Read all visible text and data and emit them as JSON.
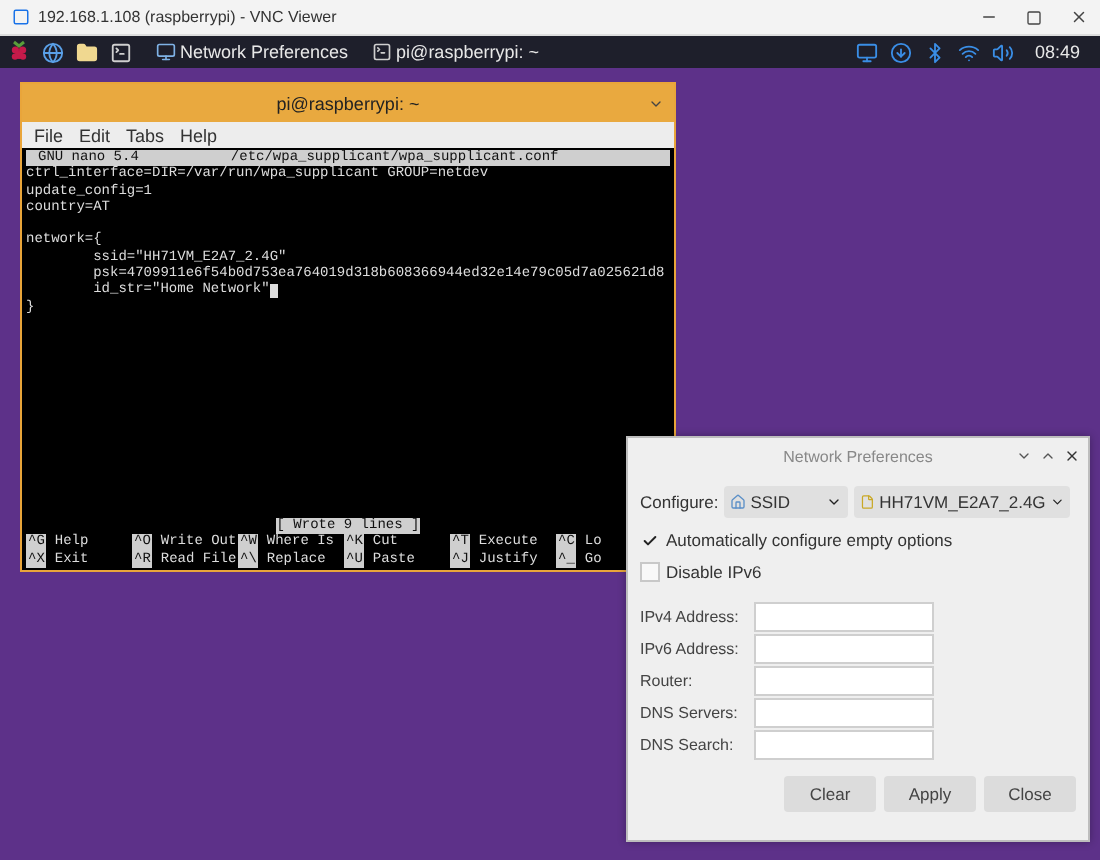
{
  "viewer": {
    "title": "192.168.1.108 (raspberrypi) - VNC Viewer"
  },
  "taskbar": {
    "tasks": [
      {
        "label": "Network Preferences",
        "kind": "network"
      },
      {
        "label": "pi@raspberrypi: ~",
        "kind": "terminal"
      }
    ],
    "clock": "08:49"
  },
  "terminal": {
    "title": "pi@raspberrypi: ~",
    "menu": [
      "File",
      "Edit",
      "Tabs",
      "Help"
    ],
    "nano": {
      "version": "GNU nano 5.4",
      "file": "/etc/wpa_supplicant/wpa_supplicant.conf",
      "blocks": [
        [
          {
            "text": "ctrl_interface=DIR=/var/run/wpa_supplicant GROUP=netdev",
            "cursor": false
          },
          {
            "text": "update_config=1",
            "cursor": false
          },
          {
            "text": "country=AT",
            "cursor": false
          }
        ],
        [
          {
            "text": "network={",
            "cursor": false
          },
          {
            "text": "        ssid=\"HH71VM_E2A7_2.4G\"",
            "cursor": false
          },
          {
            "text": "        psk=4709911e6f54b0d753ea764019d318b608366944ed32e14e79c05d7a025621d8",
            "cursor": false
          },
          {
            "text": "        id_str=\"Home Network\"",
            "cursor": true
          },
          {
            "text": "}",
            "cursor": false
          }
        ]
      ],
      "status": "[ Wrote 9 lines ]",
      "shortcuts": [
        [
          {
            "key": "^G",
            "label": "Help"
          },
          {
            "key": "^O",
            "label": "Write Out"
          },
          {
            "key": "^W",
            "label": "Where Is"
          },
          {
            "key": "^K",
            "label": "Cut"
          },
          {
            "key": "^T",
            "label": "Execute"
          },
          {
            "key": "^C",
            "label": "Lo"
          }
        ],
        [
          {
            "key": "^X",
            "label": "Exit"
          },
          {
            "key": "^R",
            "label": "Read File"
          },
          {
            "key": "^\\",
            "label": "Replace"
          },
          {
            "key": "^U",
            "label": "Paste"
          },
          {
            "key": "^J",
            "label": "Justify"
          },
          {
            "key": "^_",
            "label": "Go"
          }
        ]
      ]
    }
  },
  "dialog": {
    "title": "Network Preferences",
    "configure_label": "Configure:",
    "type_select": "SSID",
    "network_select": "HH71VM_E2A7_2.4G",
    "options": [
      {
        "label": "Automatically configure empty options",
        "checked": true
      },
      {
        "label": "Disable IPv6",
        "checked": false
      }
    ],
    "fields": [
      {
        "label": "IPv4 Address:"
      },
      {
        "label": "IPv6 Address:"
      },
      {
        "label": "Router:"
      },
      {
        "label": "DNS Servers:"
      },
      {
        "label": "DNS Search:"
      }
    ],
    "buttons": [
      "Clear",
      "Apply",
      "Close"
    ]
  }
}
